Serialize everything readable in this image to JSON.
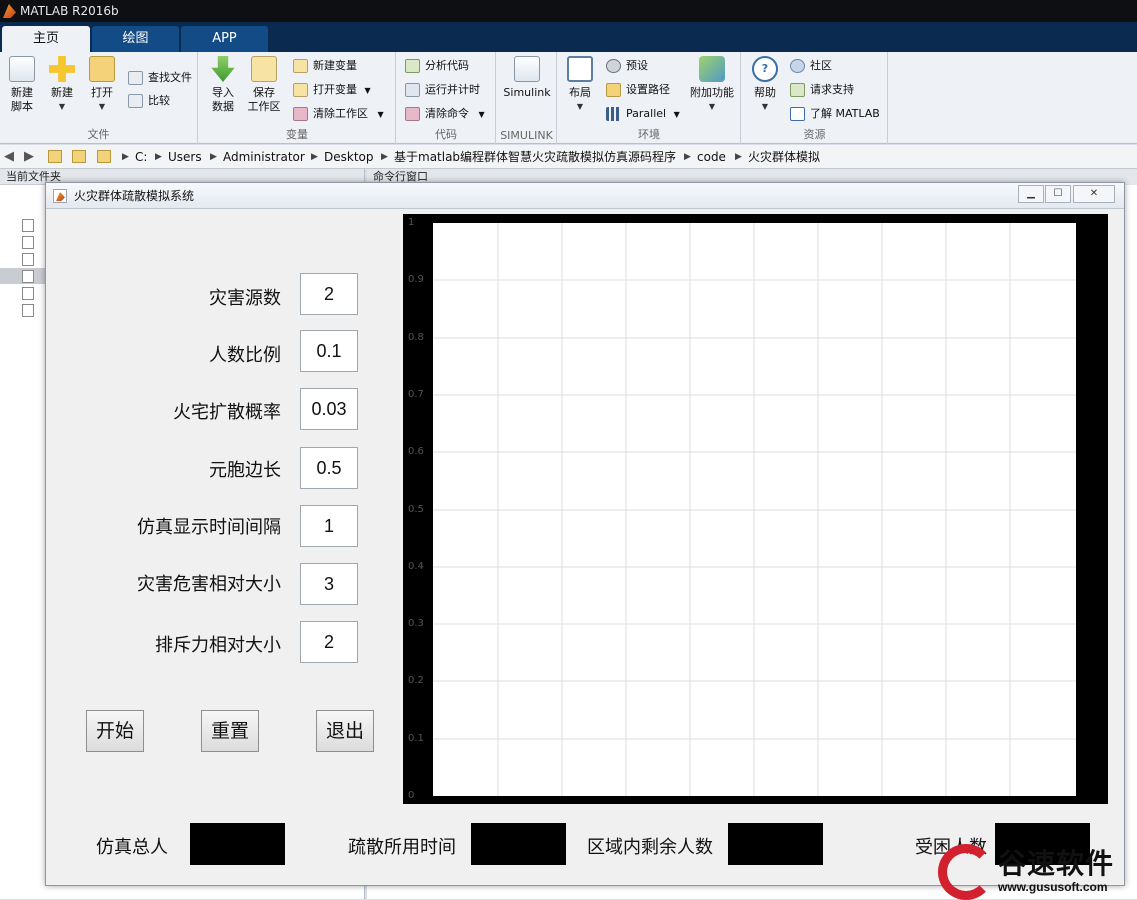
{
  "app": {
    "title": "MATLAB R2016b",
    "tabs": [
      "主页",
      "绘图",
      "APP"
    ]
  },
  "ribbon": {
    "file": {
      "group_label": "文件",
      "new_script": "新建\n脚本",
      "new": "新建",
      "open": "打开",
      "find_files": "查找文件",
      "compare": "比较"
    },
    "variable": {
      "group_label": "变量",
      "import_data": "导入\n数据",
      "save_workspace": "保存\n工作区",
      "new_variable": "新建变量",
      "open_variable": "打开变量",
      "clear_workspace": "清除工作区"
    },
    "code": {
      "group_label": "代码",
      "analyze_code": "分析代码",
      "run_and_time": "运行并计时",
      "clear_commands": "清除命令"
    },
    "simulink": {
      "group_label": "SIMULINK",
      "simulink": "Simulink"
    },
    "environment": {
      "group_label": "环境",
      "layout": "布局",
      "preferences": "预设",
      "set_path": "设置路径",
      "parallel": "Parallel",
      "addons": "附加功能"
    },
    "resources": {
      "group_label": "资源",
      "help": "帮助",
      "community": "社区",
      "request_support": "请求支持",
      "learn_matlab": "了解 MATLAB"
    }
  },
  "addressbar": {
    "crumbs": [
      "C:",
      "Users",
      "Administrator",
      "Desktop",
      "基于matlab编程群体智慧火灾疏散模拟仿真源码程序",
      "code",
      "火灾群体模拟"
    ]
  },
  "panes": {
    "current_folder": "当前文件夹",
    "command_window": "命令行窗口"
  },
  "figure": {
    "title": "火灾群体疏散模拟系统",
    "params": [
      {
        "label": "灾害源数",
        "value": "2"
      },
      {
        "label": "人数比例",
        "value": "0.1"
      },
      {
        "label": "火宅扩散概率",
        "value": "0.03"
      },
      {
        "label": "元胞边长",
        "value": "0.5"
      },
      {
        "label": "仿真显示时间间隔",
        "value": "1"
      },
      {
        "label": "灾害危害相对大小",
        "value": "3"
      },
      {
        "label": "排斥力相对大小",
        "value": "2"
      }
    ],
    "buttons": {
      "start": "开始",
      "reset": "重置",
      "exit": "退出"
    },
    "outputs": {
      "total_people": "仿真总人",
      "evac_time": "疏散所用时间",
      "remaining": "区域内剩余人数",
      "trapped": "受困人数"
    },
    "axes": {
      "yticks": [
        "1",
        "0.9",
        "0.8",
        "0.7",
        "0.6",
        "0.5",
        "0.4",
        "0.3",
        "0.2",
        "0.1",
        "0"
      ]
    }
  },
  "watermark": {
    "brand": "谷速软件",
    "url": "www.gususoft.com"
  }
}
